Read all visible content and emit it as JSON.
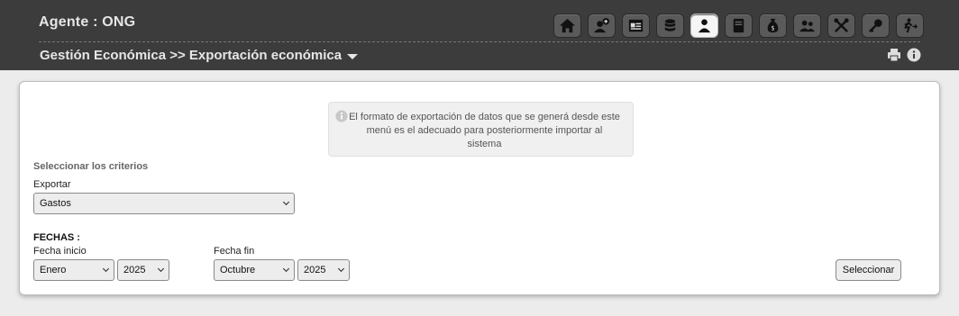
{
  "header": {
    "agent": "Agente : ONG",
    "breadcrumb": "Gestión Económica >> Exportación económica",
    "toolbar_icons": [
      "home-icon",
      "user-add-icon",
      "card-icon",
      "database-icon",
      "user-icon",
      "book-icon",
      "money-bag-icon",
      "users-icon",
      "tools-icon",
      "key-icon",
      "logout-icon"
    ],
    "active_icon": "user-icon"
  },
  "notice": {
    "text": "El formato de exportación de datos que se generá desde este menú es el adecuado para posteriormente importar al sistema"
  },
  "form": {
    "section_label": "Seleccionar los criterios",
    "export_label": "Exportar",
    "export_value": "Gastos",
    "fechas_label": "FECHAS :",
    "start_label": "Fecha inicio",
    "start_month": "Enero",
    "start_year": "2025",
    "end_label": "Fecha fin",
    "end_month": "Octubre",
    "end_year": "2025",
    "submit_label": "Seleccionar"
  }
}
